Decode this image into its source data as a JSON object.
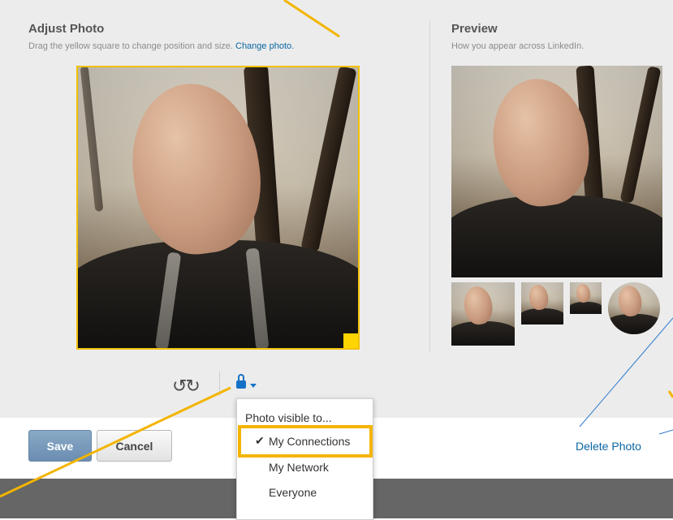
{
  "adjust": {
    "title": "Adjust Photo",
    "instruction": "Drag the yellow square to change position and size.",
    "change_photo_link": "Change photo."
  },
  "preview": {
    "title": "Preview",
    "subtitle": "How you appear across LinkedIn."
  },
  "toolbar": {
    "rotate_icon": "rotate-arrows-icon",
    "lock_icon": "lock-icon"
  },
  "visibility_menu": {
    "header": "Photo visible to...",
    "options": [
      "My Connections",
      "My Network",
      "Everyone"
    ],
    "selected": "My Connections"
  },
  "footer": {
    "save_label": "Save",
    "cancel_label": "Cancel",
    "delete_label": "Delete Photo"
  },
  "colors": {
    "link": "#0a66a3",
    "crop_border": "#f2c100",
    "highlight": "#f3b500",
    "save_button": "#7597bb"
  }
}
